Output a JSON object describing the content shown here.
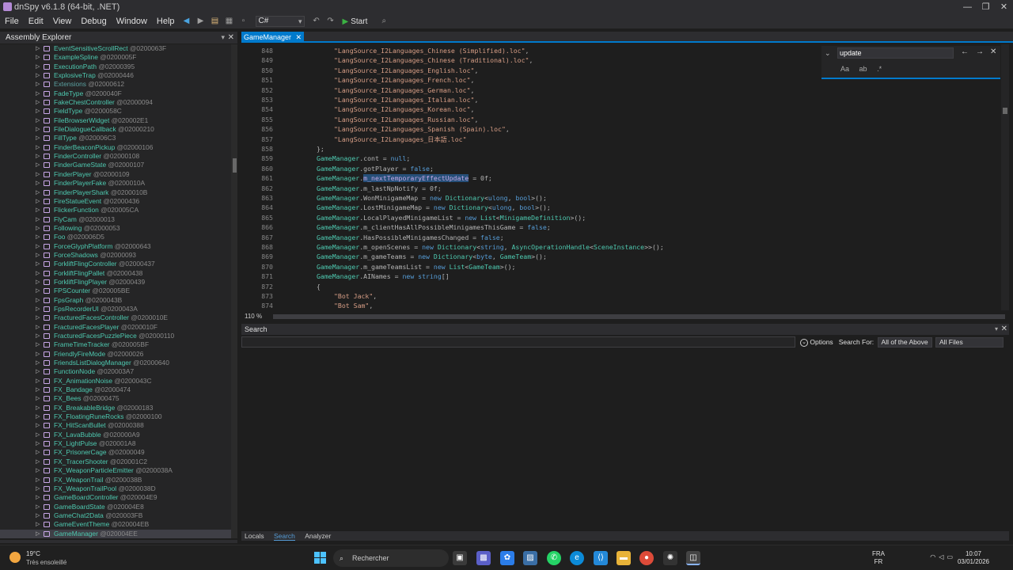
{
  "window": {
    "title": "dnSpy v6.1.8 (64-bit, .NET)",
    "minimize": "—",
    "maximize": "❐",
    "close": "✕"
  },
  "menu": [
    "File",
    "Edit",
    "View",
    "Debug",
    "Window",
    "Help"
  ],
  "toolbar": {
    "language": "C#",
    "start_label": "Start"
  },
  "assembly_explorer": {
    "title": "Assembly Explorer",
    "items": [
      {
        "name": "EventSensitiveScrollRect",
        "token": "@0200063F"
      },
      {
        "name": "ExampleSpline",
        "token": "@0200005F"
      },
      {
        "name": "ExecutionPath",
        "token": "@02000395"
      },
      {
        "name": "ExplosiveTrap",
        "token": "@02000446"
      },
      {
        "name": "Extensions",
        "token": "@02000612"
      },
      {
        "name": "FadeType",
        "token": "@0200040F"
      },
      {
        "name": "FakeChestController",
        "token": "@02000094"
      },
      {
        "name": "FieldType",
        "token": "@0200058C"
      },
      {
        "name": "FileBrowserWidget",
        "token": "@020002E1"
      },
      {
        "name": "FileDialogueCallback",
        "token": "@02000210"
      },
      {
        "name": "FillType",
        "token": "@020006C3"
      },
      {
        "name": "FinderBeaconPickup",
        "token": "@02000106"
      },
      {
        "name": "FinderController",
        "token": "@02000108"
      },
      {
        "name": "FinderGameState",
        "token": "@02000107"
      },
      {
        "name": "FinderPlayer",
        "token": "@02000109"
      },
      {
        "name": "FinderPlayerFake",
        "token": "@0200010A"
      },
      {
        "name": "FinderPlayerShark",
        "token": "@0200010B"
      },
      {
        "name": "FireStatueEvent",
        "token": "@02000436"
      },
      {
        "name": "FlickerFunction",
        "token": "@020005CA"
      },
      {
        "name": "FlyCam",
        "token": "@02000013"
      },
      {
        "name": "Following",
        "token": "@02000053"
      },
      {
        "name": "Foo",
        "token": "@020006D5"
      },
      {
        "name": "ForceGlyphPlatform",
        "token": "@02000643"
      },
      {
        "name": "ForceShadows",
        "token": "@02000093"
      },
      {
        "name": "ForkliftFlingController",
        "token": "@02000437"
      },
      {
        "name": "ForkliftFlingPallet",
        "token": "@02000438"
      },
      {
        "name": "ForkliftFlingPlayer",
        "token": "@02000439"
      },
      {
        "name": "FPSCounter",
        "token": "@020005BE"
      },
      {
        "name": "FpsGraph",
        "token": "@0200043B"
      },
      {
        "name": "FpsRecorderUI",
        "token": "@0200043A"
      },
      {
        "name": "FracturedFacesController",
        "token": "@0200010E"
      },
      {
        "name": "FracturedFacesPlayer",
        "token": "@0200010F"
      },
      {
        "name": "FracturedFacesPuzzlePiece",
        "token": "@02000110"
      },
      {
        "name": "FrameTimeTracker",
        "token": "@020005BF"
      },
      {
        "name": "FriendlyFireMode",
        "token": "@02000026"
      },
      {
        "name": "FriendsListDialogManager",
        "token": "@02000640"
      },
      {
        "name": "FunctionNode",
        "token": "@020003A7"
      },
      {
        "name": "FX_AnimationNoise",
        "token": "@0200043C"
      },
      {
        "name": "FX_Bandage",
        "token": "@02000474"
      },
      {
        "name": "FX_Bees",
        "token": "@02000475"
      },
      {
        "name": "FX_BreakableBridge",
        "token": "@02000183"
      },
      {
        "name": "FX_FloatingRuneRocks",
        "token": "@02000100"
      },
      {
        "name": "FX_HitScanBullet",
        "token": "@02000388"
      },
      {
        "name": "FX_LavaBubble",
        "token": "@020000A9"
      },
      {
        "name": "FX_LightPulse",
        "token": "@020001A8"
      },
      {
        "name": "FX_PrisonerCage",
        "token": "@02000049"
      },
      {
        "name": "FX_TracerShooter",
        "token": "@020001C2"
      },
      {
        "name": "FX_WeaponParticleEmitter",
        "token": "@0200038A"
      },
      {
        "name": "FX_WeaponTrail",
        "token": "@0200038B"
      },
      {
        "name": "FX_WeaponTrailPool",
        "token": "@0200038D"
      },
      {
        "name": "GameBoardController",
        "token": "@020004E9"
      },
      {
        "name": "GameBoardState",
        "token": "@020004E8"
      },
      {
        "name": "GameChat2Data",
        "token": "@020003FB"
      },
      {
        "name": "GameEventTheme",
        "token": "@020004EB"
      },
      {
        "name": "GameManager",
        "token": "@020004EE"
      }
    ]
  },
  "document_tab": {
    "label": "GameManager",
    "close": "✕"
  },
  "code": {
    "zoom": "110 %",
    "lines": [
      {
        "n": "848",
        "parts": [
          [
            "s",
            "\"LangSource_I2Languages_Chinese (Simplified).loc\""
          ],
          [
            "p",
            ","
          ]
        ]
      },
      {
        "n": "849",
        "parts": [
          [
            "s",
            "\"LangSource_I2Languages_Chinese (Traditional).loc\""
          ],
          [
            "p",
            ","
          ]
        ]
      },
      {
        "n": "850",
        "parts": [
          [
            "s",
            "\"LangSource_I2Languages_English.loc\""
          ],
          [
            "p",
            ","
          ]
        ]
      },
      {
        "n": "851",
        "parts": [
          [
            "s",
            "\"LangSource_I2Languages_French.loc\""
          ],
          [
            "p",
            ","
          ]
        ]
      },
      {
        "n": "852",
        "parts": [
          [
            "s",
            "\"LangSource_I2Languages_German.loc\""
          ],
          [
            "p",
            ","
          ]
        ]
      },
      {
        "n": "853",
        "parts": [
          [
            "s",
            "\"LangSource_I2Languages_Italian.loc\""
          ],
          [
            "p",
            ","
          ]
        ]
      },
      {
        "n": "854",
        "parts": [
          [
            "s",
            "\"LangSource_I2Languages_Korean.loc\""
          ],
          [
            "p",
            ","
          ]
        ]
      },
      {
        "n": "855",
        "parts": [
          [
            "s",
            "\"LangSource_I2Languages_Russian.loc\""
          ],
          [
            "p",
            ","
          ]
        ]
      },
      {
        "n": "856",
        "parts": [
          [
            "s",
            "\"LangSource_I2Languages_Spanish (Spain).loc\""
          ],
          [
            "p",
            ","
          ]
        ]
      },
      {
        "n": "857",
        "parts": [
          [
            "s",
            "\"LangSource_I2Languages_日本語.loc\""
          ]
        ]
      },
      {
        "n": "858",
        "parts": [
          [
            "p",
            "};"
          ]
        ]
      },
      {
        "n": "859",
        "parts": [
          [
            "t",
            "GameManager"
          ],
          [
            "p",
            ".cont = "
          ],
          [
            "k",
            "null"
          ],
          [
            "p",
            ";"
          ]
        ]
      },
      {
        "n": "860",
        "parts": [
          [
            "t",
            "GameManager"
          ],
          [
            "p",
            ".gotPlayer = "
          ],
          [
            "k",
            "false"
          ],
          [
            "p",
            ";"
          ]
        ]
      },
      {
        "n": "861",
        "parts": [
          [
            "t",
            "GameManager"
          ],
          [
            "p",
            "."
          ],
          [
            "hl",
            "m_nextTemporaryEffectUpdate"
          ],
          [
            "p",
            " = 0f;"
          ]
        ]
      },
      {
        "n": "862",
        "parts": [
          [
            "t",
            "GameManager"
          ],
          [
            "p",
            ".m_lastNpNotify = 0f;"
          ]
        ]
      },
      {
        "n": "863",
        "parts": [
          [
            "t",
            "GameManager"
          ],
          [
            "p",
            ".WonMinigameMap = "
          ],
          [
            "k",
            "new "
          ],
          [
            "t",
            "Dictionary"
          ],
          [
            "p",
            "<"
          ],
          [
            "k",
            "ulong"
          ],
          [
            "p",
            ", "
          ],
          [
            "k",
            "bool"
          ],
          [
            "p",
            ">();"
          ]
        ]
      },
      {
        "n": "864",
        "parts": [
          [
            "t",
            "GameManager"
          ],
          [
            "p",
            ".LostMinigameMap = "
          ],
          [
            "k",
            "new "
          ],
          [
            "t",
            "Dictionary"
          ],
          [
            "p",
            "<"
          ],
          [
            "k",
            "ulong"
          ],
          [
            "p",
            ", "
          ],
          [
            "k",
            "bool"
          ],
          [
            "p",
            ">();"
          ]
        ]
      },
      {
        "n": "865",
        "parts": [
          [
            "t",
            "GameManager"
          ],
          [
            "p",
            ".LocalPlayedMinigameList = "
          ],
          [
            "k",
            "new "
          ],
          [
            "t",
            "List"
          ],
          [
            "p",
            "<"
          ],
          [
            "t",
            "MinigameDefinition"
          ],
          [
            "p",
            ">();"
          ]
        ]
      },
      {
        "n": "866",
        "parts": [
          [
            "t",
            "GameManager"
          ],
          [
            "p",
            ".m_clientHasAllPossibleMinigamesThisGame = "
          ],
          [
            "k",
            "false"
          ],
          [
            "p",
            ";"
          ]
        ]
      },
      {
        "n": "867",
        "parts": [
          [
            "t",
            "GameManager"
          ],
          [
            "p",
            ".HasPossibleMinigamesChanged = "
          ],
          [
            "k",
            "false"
          ],
          [
            "p",
            ";"
          ]
        ]
      },
      {
        "n": "868",
        "parts": [
          [
            "t",
            "GameManager"
          ],
          [
            "p",
            ".m_openScenes = "
          ],
          [
            "k",
            "new "
          ],
          [
            "t",
            "Dictionary"
          ],
          [
            "p",
            "<"
          ],
          [
            "k",
            "string"
          ],
          [
            "p",
            ", "
          ],
          [
            "t",
            "AsyncOperationHandle"
          ],
          [
            "p",
            "<"
          ],
          [
            "t",
            "SceneInstance"
          ],
          [
            "p",
            ">>();"
          ]
        ]
      },
      {
        "n": "869",
        "parts": [
          [
            "t",
            "GameManager"
          ],
          [
            "p",
            ".m_gameTeams = "
          ],
          [
            "k",
            "new "
          ],
          [
            "t",
            "Dictionary"
          ],
          [
            "p",
            "<"
          ],
          [
            "k",
            "byte"
          ],
          [
            "p",
            ", "
          ],
          [
            "t",
            "GameTeam"
          ],
          [
            "p",
            ">();"
          ]
        ]
      },
      {
        "n": "870",
        "parts": [
          [
            "t",
            "GameManager"
          ],
          [
            "p",
            ".m_gameTeamsList = "
          ],
          [
            "k",
            "new "
          ],
          [
            "t",
            "List"
          ],
          [
            "p",
            "<"
          ],
          [
            "t",
            "GameTeam"
          ],
          [
            "p",
            ">();"
          ]
        ]
      },
      {
        "n": "871",
        "parts": [
          [
            "t",
            "GameManager"
          ],
          [
            "p",
            ".AINames = "
          ],
          [
            "k",
            "new string"
          ],
          [
            "p",
            "[]"
          ]
        ]
      },
      {
        "n": "872",
        "parts": [
          [
            "p",
            "{"
          ]
        ]
      },
      {
        "n": "873",
        "parts": [
          [
            "s",
            "\"Bot Jack\""
          ],
          [
            "p",
            ","
          ]
        ]
      },
      {
        "n": "874",
        "parts": [
          [
            "s",
            "\"Bot Sam\""
          ],
          [
            "p",
            ","
          ]
        ]
      }
    ]
  },
  "find": {
    "value": "update",
    "match_case": "Aa",
    "whole_word": "ab",
    "regex": ".*"
  },
  "search_panel": {
    "title": "Search",
    "options_label": "Options",
    "search_for_label": "Search For:",
    "search_for_value": "All of the Above",
    "scope_value": "All Files"
  },
  "bottom_tabs": [
    "Locals",
    "Search",
    "Analyzer"
  ],
  "taskbar": {
    "temperature": "19°C",
    "condition": "Très ensoleillé",
    "search_placeholder": "Rechercher",
    "lang_top": "FRA",
    "lang_bottom": "FR",
    "time": "10:07",
    "date": "03/01/2026"
  }
}
